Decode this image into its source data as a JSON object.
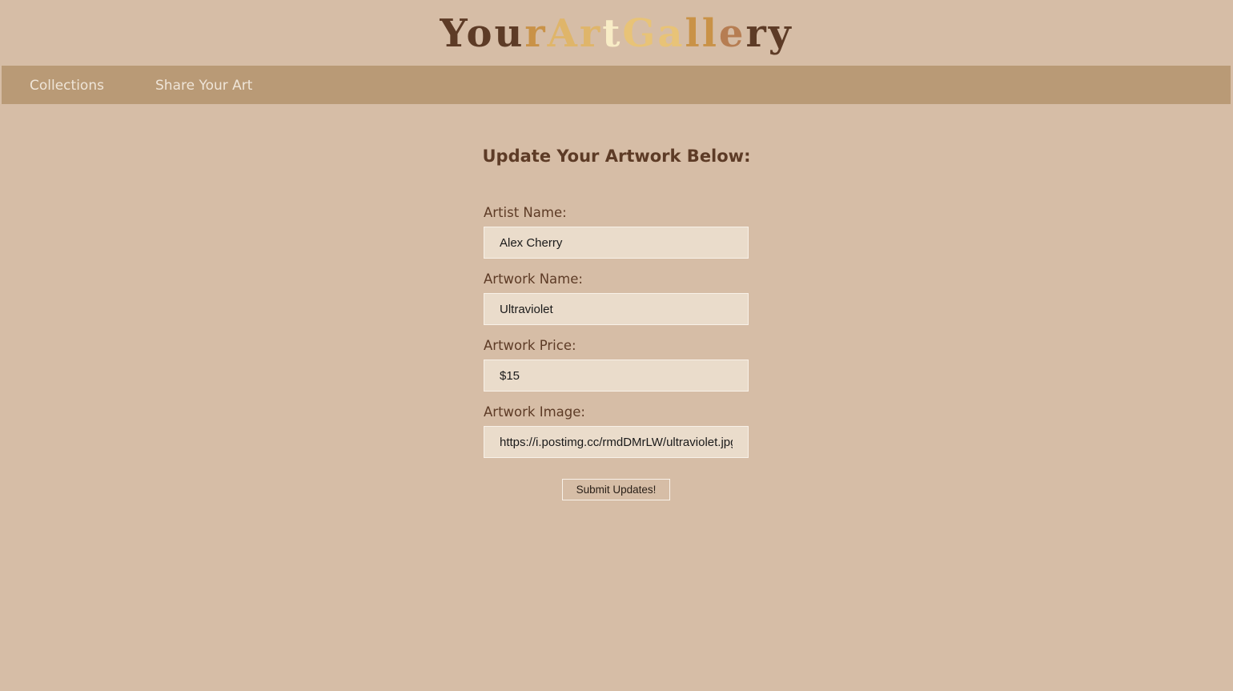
{
  "header": {
    "title_segments": [
      {
        "text": "You",
        "color": "#5d3b26"
      },
      {
        "text": "r ",
        "color": "#c99247"
      },
      {
        "text": "Ar",
        "color": "#dfb56a"
      },
      {
        "text": "t ",
        "color": "#f8ecc6"
      },
      {
        "text": "Ga",
        "color": "#e8c377"
      },
      {
        "text": "ll",
        "color": "#c99247"
      },
      {
        "text": "e",
        "color": "#b67d52"
      },
      {
        "text": "ry",
        "color": "#5d3b26"
      }
    ]
  },
  "nav": {
    "collections_label": "Collections",
    "share_label": "Share Your Art"
  },
  "form": {
    "heading": "Update Your Artwork Below:",
    "artist_name_label": "Artist Name:",
    "artist_name_value": "Alex Cherry",
    "artwork_name_label": "Artwork Name:",
    "artwork_name_value": "Ultraviolet",
    "artwork_price_label": "Artwork Price:",
    "artwork_price_value": "$15",
    "artwork_image_label": "Artwork Image:",
    "artwork_image_value": "https://i.postimg.cc/rmdDMrLW/ultraviolet.jpg",
    "submit_label": "Submit Updates!"
  },
  "colors": {
    "background": "#d6bda6",
    "navbar": "#b99a76",
    "heading_text": "#5d3b26",
    "input_background": "#eadccb"
  }
}
